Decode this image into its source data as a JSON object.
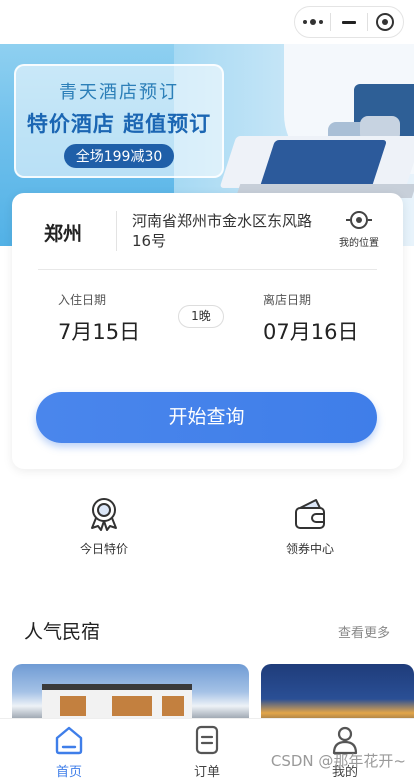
{
  "capsule": {
    "menu_icon": "more-dots-icon",
    "minimize_icon": "minus-icon",
    "close_icon": "target-circle-icon"
  },
  "banner": {
    "line1": "青天酒店预订",
    "line2": "特价酒店 超值预订",
    "promo": "全场199减30"
  },
  "search": {
    "city": "郑州",
    "address": "河南省郑州市金水区东风路16号",
    "my_location": "我的位置",
    "checkin_label": "入住日期",
    "checkin_date": "7月15日",
    "nights": "1晚",
    "checkout_label": "离店日期",
    "checkout_date": "07月16日",
    "search_button": "开始查询"
  },
  "quick": {
    "items": [
      {
        "label": "今日特价",
        "icon": "award-medal-icon"
      },
      {
        "label": "领券中心",
        "icon": "coupon-wallet-icon"
      }
    ]
  },
  "section": {
    "title": "人气民宿",
    "more": "查看更多"
  },
  "tabbar": {
    "items": [
      {
        "label": "首页",
        "icon": "home-icon",
        "active": true
      },
      {
        "label": "订单",
        "icon": "order-icon",
        "active": false
      },
      {
        "label": "我的",
        "icon": "user-icon",
        "active": false
      }
    ],
    "active_color": "#3f7ee9",
    "inactive_color": "#444444"
  },
  "watermark": "CSDN @那年花开~"
}
